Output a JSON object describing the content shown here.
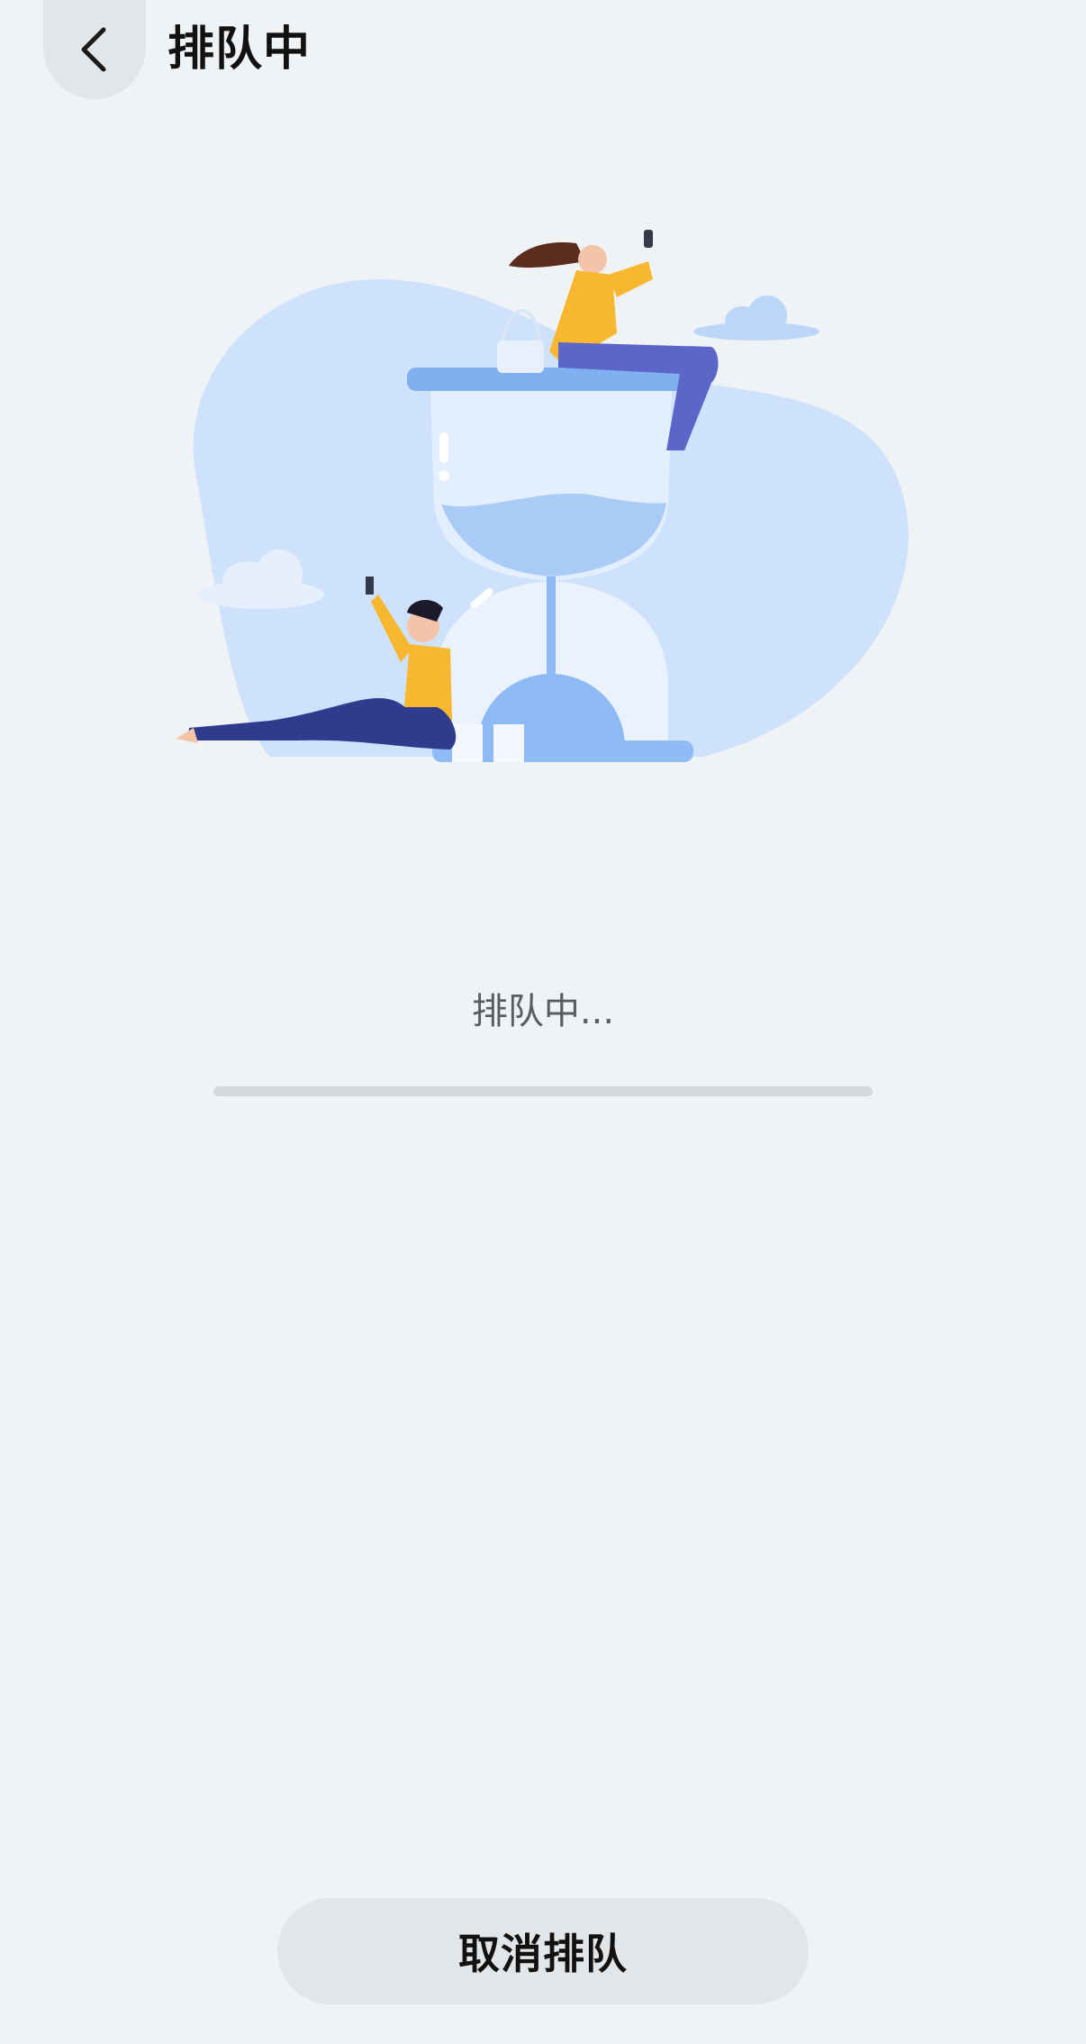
{
  "header": {
    "title": "排队中",
    "back_icon": "chevron-left-icon"
  },
  "illustration": {
    "name": "hourglass-waiting-illustration"
  },
  "queue": {
    "status_text": "排队中...",
    "progress": 0
  },
  "footer": {
    "cancel_label": "取消排队"
  },
  "colors": {
    "background": "#f0f3f5",
    "button_bg": "#e2e6e8",
    "progress_track": "#d5d8da"
  }
}
